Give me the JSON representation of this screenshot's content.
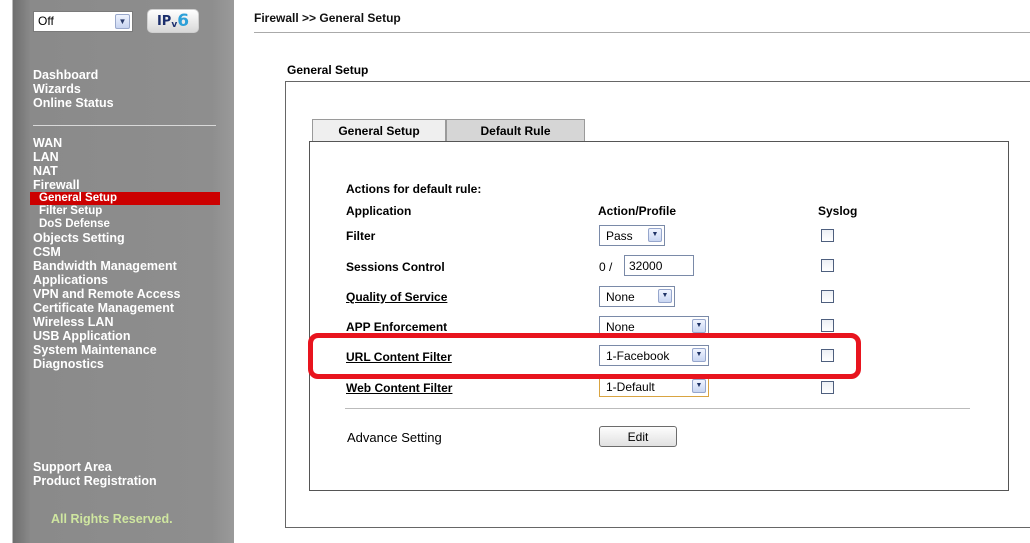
{
  "sidebar": {
    "mode_select": "Off",
    "ipv6_badge": {
      "main": "IP",
      "sub": "v",
      "six": "6"
    },
    "group1": [
      "Dashboard",
      "Wizards",
      "Online Status"
    ],
    "group2": [
      "WAN",
      "LAN",
      "NAT",
      "Firewall"
    ],
    "firewall_sub": [
      "General Setup",
      "Filter Setup",
      "DoS Defense"
    ],
    "group3": [
      "Objects Setting",
      "CSM",
      "Bandwidth Management",
      "Applications",
      "VPN and Remote Access",
      "Certificate Management",
      "Wireless LAN",
      "USB Application",
      "System Maintenance",
      "Diagnostics"
    ],
    "group4": [
      "Support Area",
      "Product Registration"
    ],
    "footer": "All Rights Reserved."
  },
  "breadcrumb": "Firewall >> General Setup",
  "section_title": "General Setup",
  "tabs": [
    "General Setup",
    "Default Rule"
  ],
  "form": {
    "heading": "Actions for default rule:",
    "col_application": "Application",
    "col_action": "Action/Profile",
    "col_syslog": "Syslog",
    "rows": [
      {
        "label": "Filter",
        "value": "Pass"
      },
      {
        "label": "Sessions Control",
        "prefix": "0 /",
        "value": "32000"
      },
      {
        "label": "Quality of Service",
        "value": "None"
      },
      {
        "label": "APP Enforcement",
        "value": "None"
      },
      {
        "label": "URL Content Filter",
        "value": "1-Facebook"
      },
      {
        "label": "Web Content Filter",
        "value": "1-Default"
      }
    ],
    "advance_label": "Advance Setting",
    "edit_button": "Edit"
  }
}
